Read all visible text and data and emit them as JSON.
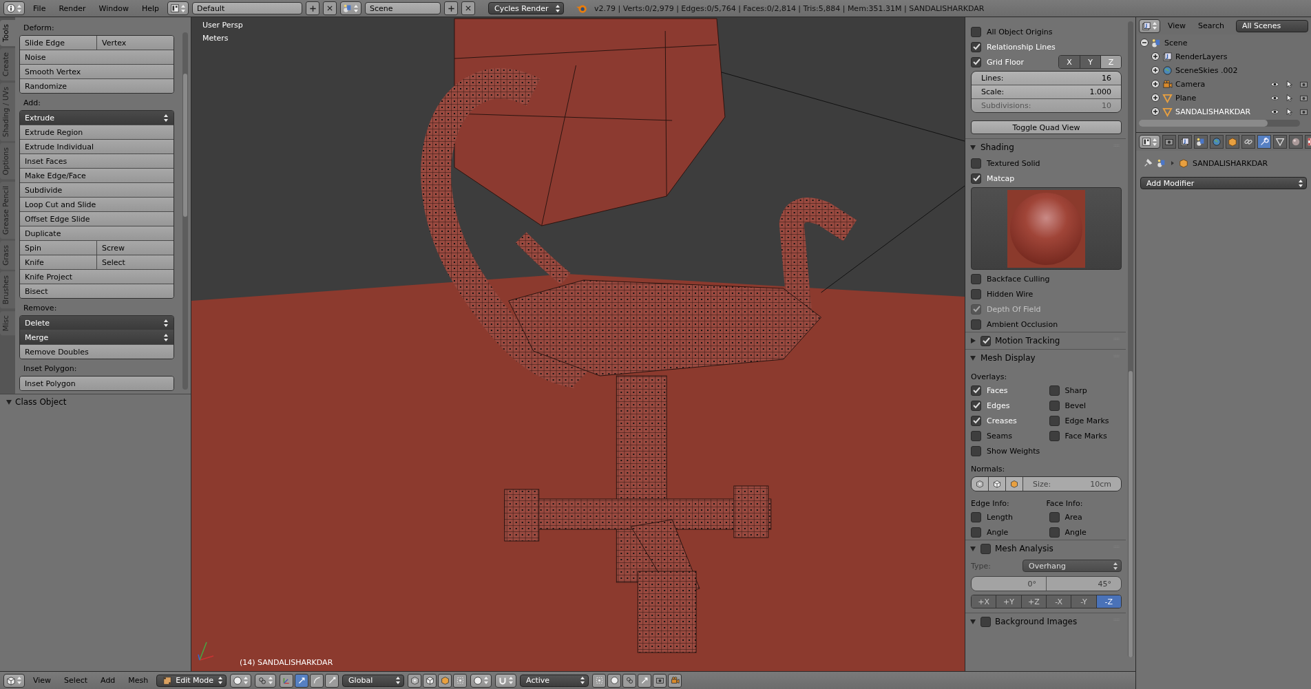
{
  "topbar": {
    "menus": [
      "File",
      "Render",
      "Window",
      "Help"
    ],
    "layout": "Default",
    "scene": "Scene",
    "engine": "Cycles Render",
    "stats": "v2.79 | Verts:0/2,979 | Edges:0/5,764 | Faces:0/2,814 | Tris:5,884 | Mem:351.31M | SANDALISHARKDAR"
  },
  "tool_shelf": {
    "tabs": [
      {
        "label": "Tools",
        "selected": true
      },
      {
        "label": "Create",
        "selected": false
      },
      {
        "label": "Shading / UVs",
        "selected": false
      },
      {
        "label": "Options",
        "selected": false
      },
      {
        "label": "Grease Pencil",
        "selected": false
      },
      {
        "label": "Grass",
        "selected": false
      },
      {
        "label": "Brushes",
        "selected": false
      },
      {
        "label": "Misc",
        "selected": false
      }
    ],
    "sections": [
      {
        "label": "Deform:",
        "rows": [
          [
            {
              "label": "Slide Edge",
              "kind": "button"
            },
            {
              "label": "Vertex",
              "kind": "button"
            }
          ],
          [
            {
              "label": "Noise",
              "kind": "button"
            }
          ],
          [
            {
              "label": "Smooth Vertex",
              "kind": "button"
            }
          ],
          [
            {
              "label": "Randomize",
              "kind": "button"
            }
          ]
        ]
      },
      {
        "label": "Add:",
        "rows": [
          [
            {
              "label": "Extrude",
              "kind": "dropdown"
            }
          ],
          [
            {
              "label": "Extrude Region",
              "kind": "button"
            }
          ],
          [
            {
              "label": "Extrude Individual",
              "kind": "button"
            }
          ],
          [
            {
              "label": "Inset Faces",
              "kind": "button"
            }
          ],
          [
            {
              "label": "Make Edge/Face",
              "kind": "button"
            }
          ],
          [
            {
              "label": "Subdivide",
              "kind": "button"
            }
          ],
          [
            {
              "label": "Loop Cut and Slide",
              "kind": "button"
            }
          ],
          [
            {
              "label": "Offset Edge Slide",
              "kind": "button"
            }
          ],
          [
            {
              "label": "Duplicate",
              "kind": "button"
            }
          ],
          [
            {
              "label": "Spin",
              "kind": "button"
            },
            {
              "label": "Screw",
              "kind": "button"
            }
          ],
          [
            {
              "label": "Knife",
              "kind": "button"
            },
            {
              "label": "Select",
              "kind": "button"
            }
          ],
          [
            {
              "label": "Knife Project",
              "kind": "button"
            }
          ],
          [
            {
              "label": "Bisect",
              "kind": "button"
            }
          ]
        ]
      },
      {
        "label": "Remove:",
        "rows": [
          [
            {
              "label": "Delete",
              "kind": "dropdown"
            }
          ],
          [
            {
              "label": "Merge",
              "kind": "dropdown"
            }
          ],
          [
            {
              "label": "Remove Doubles",
              "kind": "button"
            }
          ]
        ]
      },
      {
        "label": "Inset Polygon:",
        "rows": [
          [
            {
              "label": "Inset Polygon",
              "kind": "button"
            }
          ]
        ]
      }
    ]
  },
  "class_panel": {
    "label": "Class Object",
    "expanded": true
  },
  "viewport": {
    "view": "User Persp",
    "units": "Meters",
    "object": "(14) SANDALISHARKDAR"
  },
  "n_panel": {
    "rows": [
      {
        "kind": "checkbox",
        "label": "All Object Origins",
        "checked": false
      },
      {
        "kind": "checkbox",
        "label": "Relationship Lines",
        "checked": true
      },
      {
        "kind": "grid_floor",
        "label": "Grid Floor",
        "checked": true,
        "axes": [
          {
            "label": "X",
            "selected": true
          },
          {
            "label": "Y",
            "selected": true
          },
          {
            "label": "Z",
            "selected": false
          }
        ]
      },
      {
        "kind": "numbers",
        "fields": [
          {
            "label": "Lines:",
            "value": "16",
            "disabled": false
          },
          {
            "label": "Scale:",
            "value": "1.000",
            "disabled": false
          },
          {
            "label": "Subdivisions:",
            "value": "10",
            "disabled": true
          }
        ]
      },
      {
        "kind": "button",
        "label": "Toggle Quad View"
      },
      {
        "kind": "header",
        "label": "Shading",
        "expanded": true
      },
      {
        "kind": "checkbox",
        "label": "Textured Solid",
        "checked": false
      },
      {
        "kind": "checkbox",
        "label": "Matcap",
        "checked": true
      },
      {
        "kind": "matcap"
      },
      {
        "kind": "checkbox",
        "label": "Backface Culling",
        "checked": false
      },
      {
        "kind": "checkbox",
        "label": "Hidden Wire",
        "checked": false
      },
      {
        "kind": "checkbox",
        "label": "Depth Of Field",
        "checked": true,
        "disabled": true
      },
      {
        "kind": "checkbox",
        "label": "Ambient Occlusion",
        "checked": false
      },
      {
        "kind": "header",
        "label": "Motion Tracking",
        "expanded": false,
        "checked": true
      },
      {
        "kind": "header",
        "label": "Mesh Display",
        "expanded": true
      },
      {
        "kind": "labels",
        "labels": [
          "Overlays:"
        ]
      },
      {
        "kind": "pair",
        "items": [
          {
            "label": "Faces",
            "checked": true
          },
          {
            "label": "Sharp",
            "checked": false
          }
        ]
      },
      {
        "kind": "pair",
        "items": [
          {
            "label": "Edges",
            "checked": true
          },
          {
            "label": "Bevel",
            "checked": false
          }
        ]
      },
      {
        "kind": "pair",
        "items": [
          {
            "label": "Creases",
            "checked": true
          },
          {
            "label": "Edge Marks",
            "checked": false
          }
        ]
      },
      {
        "kind": "pair",
        "items": [
          {
            "label": "Seams",
            "checked": false
          },
          {
            "label": "Face Marks",
            "checked": false
          }
        ]
      },
      {
        "kind": "checkbox",
        "label": "Show Weights",
        "checked": false
      },
      {
        "kind": "labels",
        "labels": [
          "Normals:"
        ]
      },
      {
        "kind": "normals",
        "label": "Size:",
        "value": "10cm"
      },
      {
        "kind": "labels",
        "labels": [
          "Edge Info:",
          "Face Info:"
        ]
      },
      {
        "kind": "pair",
        "items": [
          {
            "label": "Length",
            "checked": false
          },
          {
            "label": "Area",
            "checked": false
          }
        ]
      },
      {
        "kind": "pair",
        "items": [
          {
            "label": "Angle",
            "checked": false
          },
          {
            "label": "Angle",
            "checked": false
          }
        ]
      },
      {
        "kind": "header",
        "label": "Mesh Analysis",
        "expanded": true,
        "checked": false
      },
      {
        "kind": "dropdown",
        "label": "Type:",
        "value": "Overhang"
      },
      {
        "kind": "range",
        "values": [
          "0°",
          "45°"
        ]
      },
      {
        "kind": "axes",
        "axes": [
          {
            "label": "+X",
            "selected": false
          },
          {
            "label": "+Y",
            "selected": false
          },
          {
            "label": "+Z",
            "selected": false
          },
          {
            "label": "-X",
            "selected": false
          },
          {
            "label": "-Y",
            "selected": false
          },
          {
            "label": "-Z",
            "selected": true
          }
        ]
      },
      {
        "kind": "header",
        "label": "Background Images",
        "expanded": true,
        "checked": false
      }
    ]
  },
  "outliner": {
    "menus": [
      "View",
      "Search"
    ],
    "filter": "All Scenes",
    "tree": [
      {
        "label": "Scene",
        "kind": "scene",
        "expanded": true,
        "selected": false,
        "children": [
          {
            "label": "RenderLayers",
            "kind": "layers",
            "expanded": false,
            "selected": false
          },
          {
            "label": "SceneSkies .002",
            "kind": "world",
            "expanded": false,
            "selected": false
          },
          {
            "label": "Camera",
            "kind": "camera",
            "expanded": false,
            "selected": false,
            "restrict": true
          },
          {
            "label": "Plane",
            "kind": "mesh",
            "expanded": false,
            "selected": false,
            "restrict": true
          },
          {
            "label": "SANDALISHARKDAR",
            "kind": "mesh",
            "expanded": false,
            "selected": true,
            "restrict": true
          }
        ]
      }
    ]
  },
  "properties": {
    "tabs": [
      {
        "kind": "render",
        "selected": false
      },
      {
        "kind": "layers",
        "selected": false
      },
      {
        "kind": "scene",
        "selected": false
      },
      {
        "kind": "world",
        "selected": false
      },
      {
        "kind": "object",
        "selected": false
      },
      {
        "kind": "constraints",
        "selected": false
      },
      {
        "kind": "modifiers",
        "selected": true
      },
      {
        "kind": "data",
        "selected": false
      },
      {
        "kind": "material",
        "selected": false
      },
      {
        "kind": "texture",
        "selected": false
      }
    ],
    "object": "SANDALISHARKDAR",
    "add_modifier": "Add Modifier"
  },
  "bottombar": {
    "menus": [
      "View",
      "Select",
      "Add",
      "Mesh"
    ],
    "mode": "Edit Mode",
    "orientation": "Global",
    "pivot": "Active"
  }
}
